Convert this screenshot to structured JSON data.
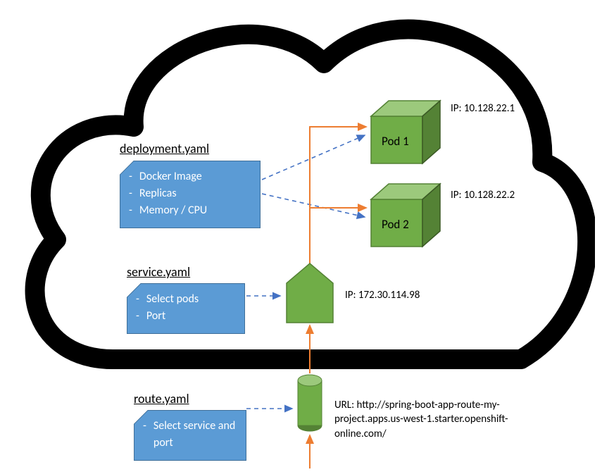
{
  "deployment": {
    "label": "deployment.yaml",
    "items": [
      "Docker Image",
      "Replicas",
      "Memory / CPU"
    ]
  },
  "service": {
    "label": "service.yaml",
    "items": [
      "Select pods",
      "Port"
    ],
    "ip_label": "IP: 172.30.114.98"
  },
  "route": {
    "label": "route.yaml",
    "items": [
      "Select service and port"
    ],
    "url_label": "URL: http://spring-boot-app-route-my-project.apps.us-west-1.starter.openshift-online.com/"
  },
  "pods": [
    {
      "name": "Pod 1",
      "ip": "IP: 10.128.22.1"
    },
    {
      "name": "Pod 2",
      "ip": "IP: 10.128.22.2"
    }
  ],
  "colors": {
    "box": "#5b9bd5",
    "green_fill": "#70AD47",
    "green_light": "#9CC97C",
    "green_dark": "#548235",
    "orange": "#ED7D31",
    "dashed": "#4472C4"
  }
}
